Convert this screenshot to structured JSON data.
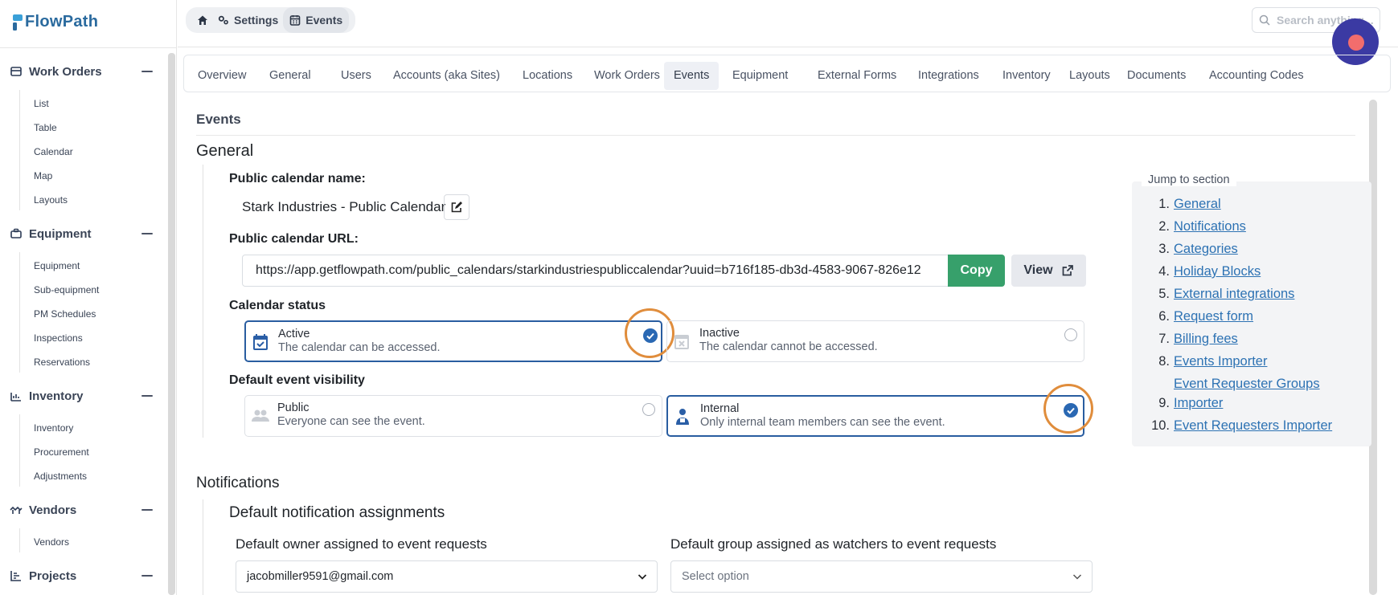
{
  "app": {
    "name": "FlowPath"
  },
  "sidebar": {
    "sections": [
      {
        "label": "Work Orders",
        "icon": "work-orders-icon",
        "items": [
          "List",
          "Table",
          "Calendar",
          "Map",
          "Layouts"
        ]
      },
      {
        "label": "Equipment",
        "icon": "equipment-icon",
        "items": [
          "Equipment",
          "Sub-equipment",
          "PM Schedules",
          "Inspections",
          "Reservations"
        ]
      },
      {
        "label": "Inventory",
        "icon": "inventory-icon",
        "items": [
          "Inventory",
          "Procurement",
          "Adjustments"
        ]
      },
      {
        "label": "Vendors",
        "icon": "vendors-icon",
        "items": [
          "Vendors"
        ]
      },
      {
        "label": "Projects",
        "icon": "projects-icon",
        "items": []
      }
    ]
  },
  "breadcrumb": {
    "settings": "Settings",
    "events": "Events"
  },
  "search": {
    "placeholder": "Search anything..."
  },
  "tabs": [
    "Overview",
    "General",
    "Users",
    "Accounts (aka Sites)",
    "Locations",
    "Work Orders",
    "Events",
    "Equipment",
    "External Forms",
    "Integrations",
    "Inventory",
    "Layouts",
    "Documents",
    "Accounting Codes"
  ],
  "active_tab": "Events",
  "page": {
    "title": "Events",
    "general_heading": "General",
    "public_name_label": "Public calendar name:",
    "public_name_value": "Stark Industries - Public Calendar",
    "public_url_label": "Public calendar URL:",
    "public_url_value": "https://app.getflowpath.com/public_calendars/starkindustriespubliccalendar?uuid=b716f185-db3d-4583-9067-826e12",
    "copy_label": "Copy",
    "view_label": "View",
    "status_label": "Calendar status",
    "status_options": [
      {
        "title": "Active",
        "desc": "The calendar can be accessed.",
        "selected": true
      },
      {
        "title": "Inactive",
        "desc": "The calendar cannot be accessed.",
        "selected": false
      }
    ],
    "visibility_label": "Default event visibility",
    "visibility_options": [
      {
        "title": "Public",
        "desc": "Everyone can see the event.",
        "selected": false
      },
      {
        "title": "Internal",
        "desc": "Only internal team members can see the event.",
        "selected": true
      }
    ],
    "notifications_heading": "Notifications",
    "assignments_heading": "Default notification assignments",
    "owner_label": "Default owner assigned to event requests",
    "owner_value": "jacobmiller9591@gmail.com",
    "watchers_label": "Default group assigned as watchers to event requests",
    "watchers_placeholder": "Select option"
  },
  "jump": {
    "legend": "Jump to section",
    "items": [
      {
        "num": "1.",
        "label": "General"
      },
      {
        "num": "2.",
        "label": "Notifications"
      },
      {
        "num": "3.",
        "label": "Categories"
      },
      {
        "num": "4.",
        "label": "Holiday Blocks"
      },
      {
        "num": "5.",
        "label": "External integrations"
      },
      {
        "num": "6.",
        "label": "Request form"
      },
      {
        "num": "7.",
        "label": "Billing fees"
      },
      {
        "num": "8.",
        "label": "Events Importer"
      },
      {
        "num": "",
        "label": "Event Requester Groups"
      },
      {
        "num": "9.",
        "label": "Importer"
      },
      {
        "num": "10.",
        "label": "Event Requesters Importer"
      }
    ]
  },
  "colors": {
    "accent": "#2a68b3",
    "copy": "#37a06b",
    "highlight_ring": "#e08d3c",
    "link": "#2d72b3"
  }
}
